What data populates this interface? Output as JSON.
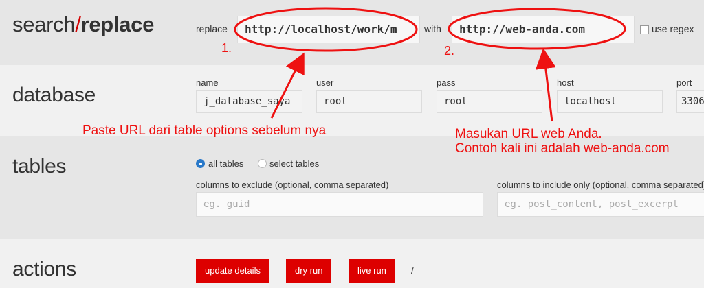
{
  "header": {
    "logo_left": "search",
    "logo_slash": "/",
    "logo_right": "replace",
    "replace_label": "replace",
    "replace_value": "http://localhost/work/m",
    "with_label": "with",
    "with_value": "http://web-anda.com",
    "use_regex_label": "use regex"
  },
  "database": {
    "title": "database",
    "fields": [
      {
        "label": "name",
        "value": "j_database_saya"
      },
      {
        "label": "user",
        "value": "root"
      },
      {
        "label": "pass",
        "value": "root"
      },
      {
        "label": "host",
        "value": "localhost"
      },
      {
        "label": "port",
        "value": "3306"
      }
    ]
  },
  "tables": {
    "title": "tables",
    "options": [
      {
        "label": "all tables",
        "selected": true
      },
      {
        "label": "select tables",
        "selected": false
      }
    ],
    "exclude_label": "columns to exclude (optional, comma separated)",
    "exclude_placeholder": "eg. guid",
    "include_label": "columns to include only (optional, comma separated)",
    "include_placeholder": "eg. post_content, post_excerpt"
  },
  "actions": {
    "title": "actions",
    "buttons": [
      "update details",
      "dry run",
      "live run"
    ],
    "trailing": "/"
  },
  "annotations": {
    "marker_1": "1.",
    "marker_2": "2.",
    "note_1": "Paste URL dari table options sebelum nya",
    "note_2_line1": "Masukan URL web Anda.",
    "note_2_line2": "Contoh kali ini adalah web-anda.com",
    "color": "#ee1111"
  },
  "colors": {
    "accent": "#dd0000",
    "radio_selected": "#2a79c9"
  }
}
